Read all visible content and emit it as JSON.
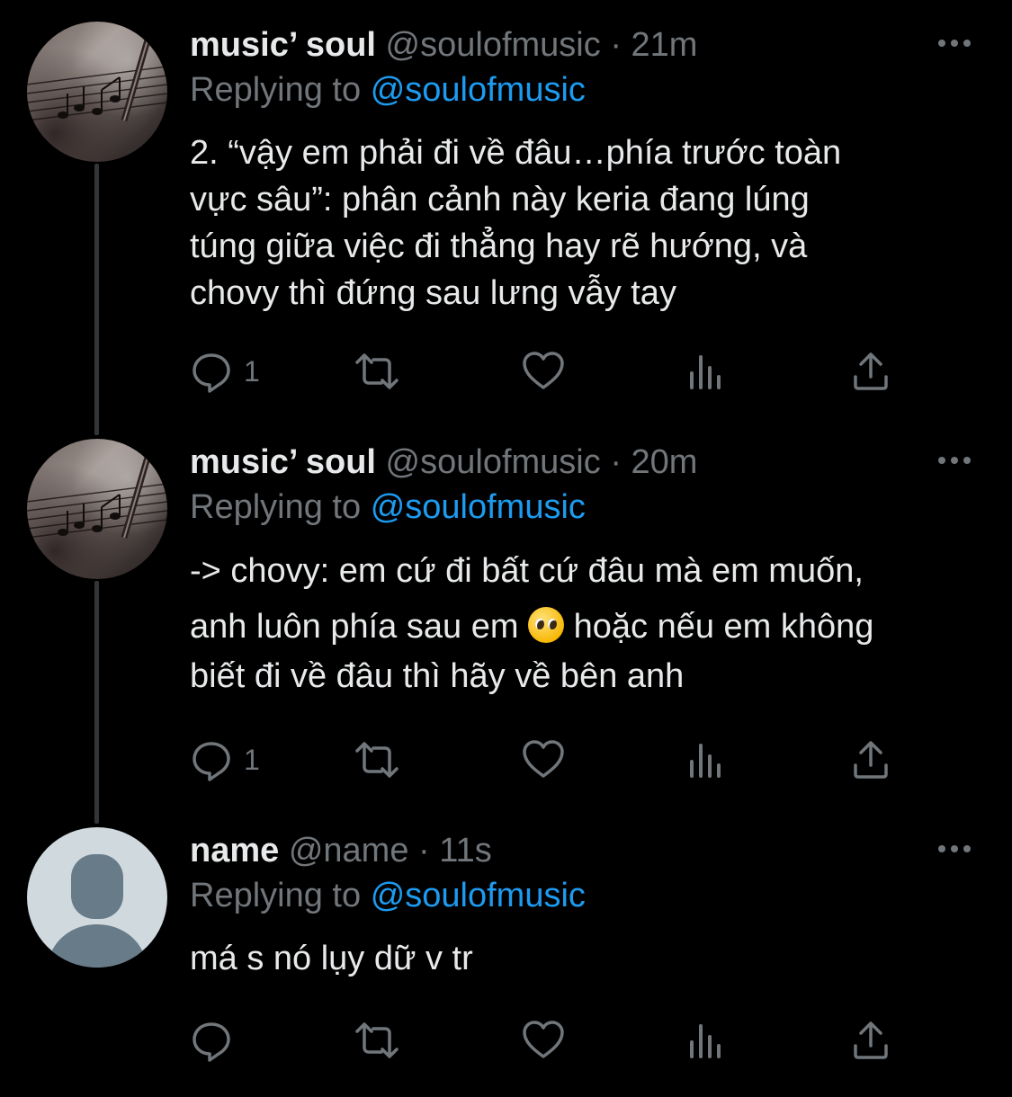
{
  "tweets": [
    {
      "name": "music’ soul",
      "handle": "@soulofmusic",
      "separator": "·",
      "time": "21m",
      "replying_prefix": "Replying to",
      "replying_handle": "@soulofmusic",
      "lines": [
        "2. “vậy em phải đi về đâu…phía trước toàn",
        "vực sâu”: phân cảnh này keria đang lúng",
        "túng giữa việc đi thẳng hay rẽ hướng, và",
        "chovy thì đứng sau lưng vẫy tay"
      ],
      "reply_count": "1",
      "avatar_icon": "music-sheet-avatar"
    },
    {
      "name": "music’ soul",
      "handle": "@soulofmusic",
      "separator": "·",
      "time": "20m",
      "replying_prefix": "Replying to",
      "replying_handle": "@soulofmusic",
      "line1": "-> chovy: em cứ đi bất cứ đâu mà em muốn,",
      "line2_before": "anh luôn phía sau em",
      "line2_emoji": "pleading-face-emoji",
      "line2_after": "hoặc nếu em không",
      "line3": "biết đi về đâu thì hãy về bên anh",
      "reply_count": "1",
      "avatar_icon": "music-sheet-avatar"
    },
    {
      "name": "name",
      "handle": "@name",
      "separator": "·",
      "time": "11s",
      "replying_prefix": "Replying to",
      "replying_handle": "@soulofmusic",
      "lines": [
        "má s nó lụy dữ v tr"
      ],
      "reply_count": "",
      "avatar_icon": "default-user-avatar"
    }
  ],
  "icons": [
    "reply-icon",
    "retweet-icon",
    "like-icon",
    "views-icon",
    "share-icon",
    "more-icon"
  ],
  "colors": {
    "background": "#000000",
    "text": "#e7e9ea",
    "muted": "#71767b",
    "link": "#1d9bf0",
    "thread_line": "#333639"
  }
}
